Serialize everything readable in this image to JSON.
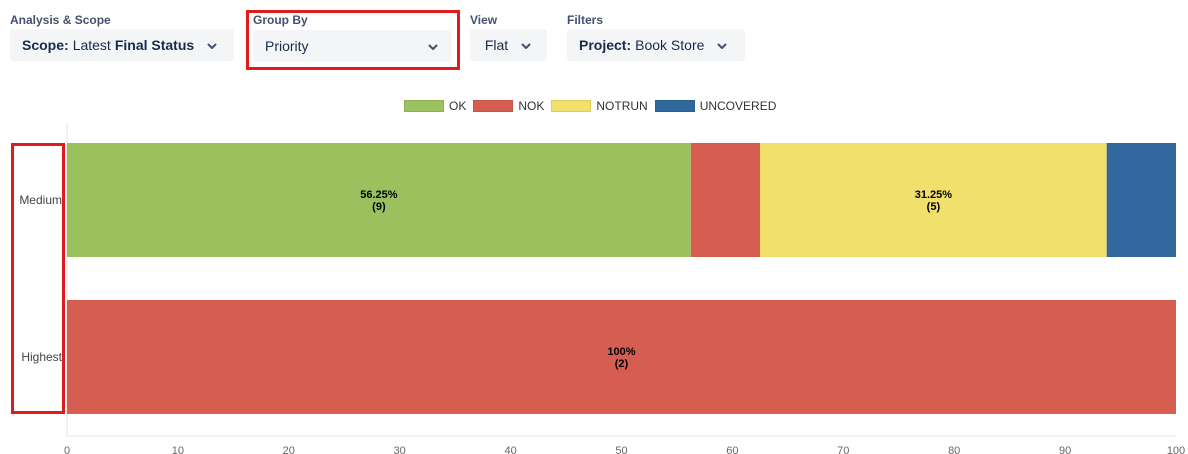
{
  "filters": {
    "scope": {
      "title": "Analysis & Scope",
      "prefix": "Scope:",
      "value_plain": "Latest",
      "value_bold": "Final Status"
    },
    "group_by": {
      "title": "Group By",
      "value": "Priority"
    },
    "view": {
      "title": "View",
      "value": "Flat"
    },
    "project": {
      "title": "Filters",
      "prefix": "Project:",
      "value": "Book Store"
    }
  },
  "colors": {
    "ok": "#9bc15f",
    "nok": "#d55e50",
    "notrun": "#f1e06b",
    "uncovered": "#31699e",
    "highlight": "#e01b1b"
  },
  "icons": [
    "chevron-down-icon"
  ],
  "chart_data": {
    "type": "bar",
    "orientation": "horizontal",
    "stacked": true,
    "categories": [
      "Medium",
      "Highest"
    ],
    "series": [
      {
        "name": "OK",
        "color": "#9bc15f",
        "values": [
          56.25,
          0
        ],
        "counts": [
          9,
          0
        ]
      },
      {
        "name": "NOK",
        "color": "#d55e50",
        "values": [
          6.25,
          100
        ],
        "counts": [
          1,
          2
        ]
      },
      {
        "name": "NOTRUN",
        "color": "#f1e06b",
        "values": [
          31.25,
          0
        ],
        "counts": [
          5,
          0
        ]
      },
      {
        "name": "UNCOVERED",
        "color": "#31699e",
        "values": [
          6.25,
          0
        ],
        "counts": [
          1,
          0
        ]
      }
    ],
    "data_labels": [
      {
        "category": "Medium",
        "series": "OK",
        "line1": "56.25%",
        "line2": "(9)"
      },
      {
        "category": "Medium",
        "series": "NOTRUN",
        "line1": "31.25%",
        "line2": "(5)"
      },
      {
        "category": "Highest",
        "series": "NOK",
        "line1": "100%",
        "line2": "(2)"
      }
    ],
    "xlim": [
      0,
      100
    ],
    "xticks": [
      0,
      10,
      20,
      30,
      40,
      50,
      60,
      70,
      80,
      90,
      100
    ],
    "legend_position": "top-center",
    "grid": false
  }
}
